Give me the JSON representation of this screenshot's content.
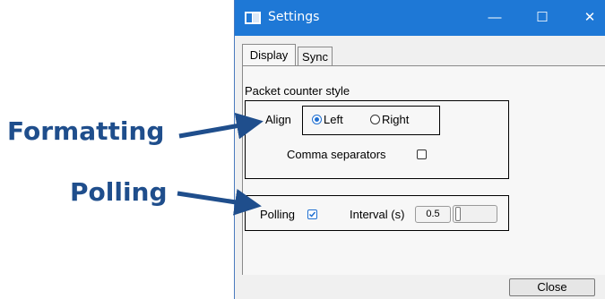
{
  "annotations": {
    "formatting": "Formatting",
    "polling": "Polling"
  },
  "window": {
    "title": "Settings",
    "minimize_symbol": "—",
    "maximize_symbol": "☐",
    "close_symbol": "✕"
  },
  "tabs": [
    {
      "label": "Display",
      "active": true
    },
    {
      "label": "Sync",
      "active": false
    }
  ],
  "display": {
    "section_label": "Packet counter style",
    "align_label": "Align",
    "align_options": [
      {
        "label": "Left",
        "selected": true
      },
      {
        "label": "Right",
        "selected": false
      }
    ],
    "comma_label": "Comma separators",
    "comma_checked": false,
    "polling_label": "Polling",
    "polling_checked": true,
    "interval_label": "Interval (s)",
    "interval_value": "0.5"
  },
  "footer": {
    "close_label": "Close"
  },
  "colors": {
    "titlebar": "#1e78d6",
    "annotation": "#1f4e8c"
  }
}
